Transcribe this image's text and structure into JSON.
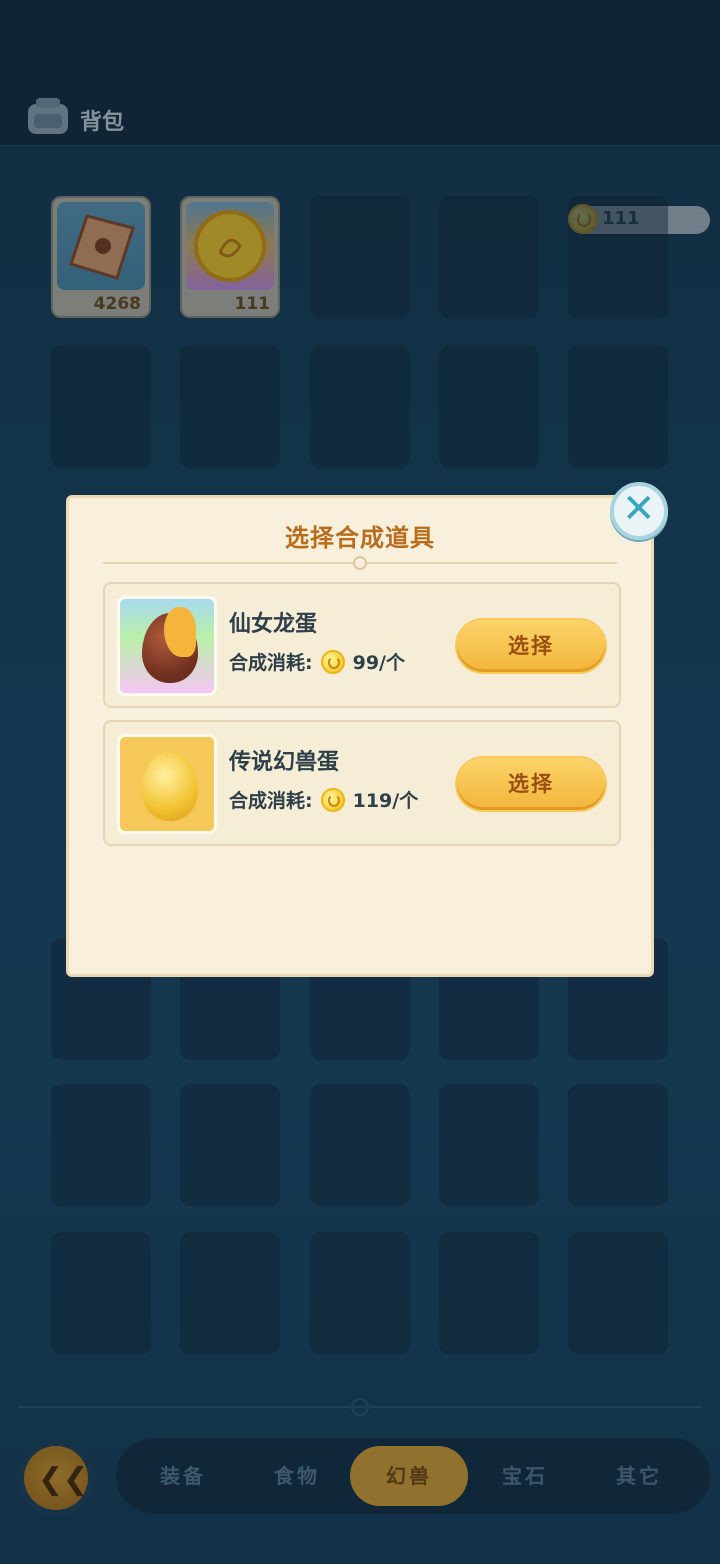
{
  "header": {
    "title": "背包"
  },
  "currency": {
    "amount": "111"
  },
  "inventory": [
    {
      "icon": "pet-scroll-icon",
      "count": "4268"
    },
    {
      "icon": "coin-orb-icon",
      "count": "111"
    }
  ],
  "tabs": [
    {
      "label": "装备",
      "active": false
    },
    {
      "label": "食物",
      "active": false
    },
    {
      "label": "幻兽",
      "active": true
    },
    {
      "label": "宝石",
      "active": false
    },
    {
      "label": "其它",
      "active": false
    }
  ],
  "dialog": {
    "title": "选择合成道具",
    "items": [
      {
        "name": "仙女龙蛋",
        "cost_label": "合成消耗:",
        "cost": "99/个",
        "button": "选择",
        "icon": "fairy-dragon-egg-icon"
      },
      {
        "name": "传说幻兽蛋",
        "cost_label": "合成消耗:",
        "cost": "119/个",
        "button": "选择",
        "icon": "legend-egg-icon"
      }
    ]
  }
}
